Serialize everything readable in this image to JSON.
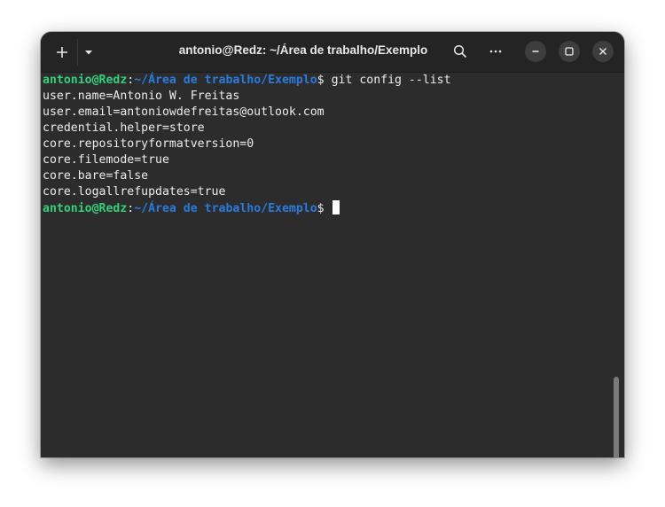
{
  "window": {
    "title": "antonio@Redz: ~/Área de trabalho/Exemplo"
  },
  "titlebar": {
    "icons": {
      "new_tab": "plus-icon",
      "tab_menu": "chevron-down-icon",
      "search": "search-icon",
      "menu": "ellipsis-icon",
      "minimize": "minimize-icon",
      "maximize": "maximize-icon",
      "close": "close-icon"
    }
  },
  "colors": {
    "user_host": "#33d17a",
    "path": "#2a7bde",
    "text": "#ececec",
    "background": "#2c2c2c",
    "titlebar": "#242424"
  },
  "terminal": {
    "prompt": {
      "user_host": "antonio@Redz",
      "separator": ":",
      "path": "~/Área de trabalho/Exemplo",
      "symbol": "$"
    },
    "command": " git config --list",
    "output": [
      "user.name=Antonio W. Freitas",
      "user.email=antoniowdefreitas@outlook.com",
      "credential.helper=store",
      "core.repositoryformatversion=0",
      "core.filemode=true",
      "core.bare=false",
      "core.logallrefupdates=true"
    ]
  }
}
